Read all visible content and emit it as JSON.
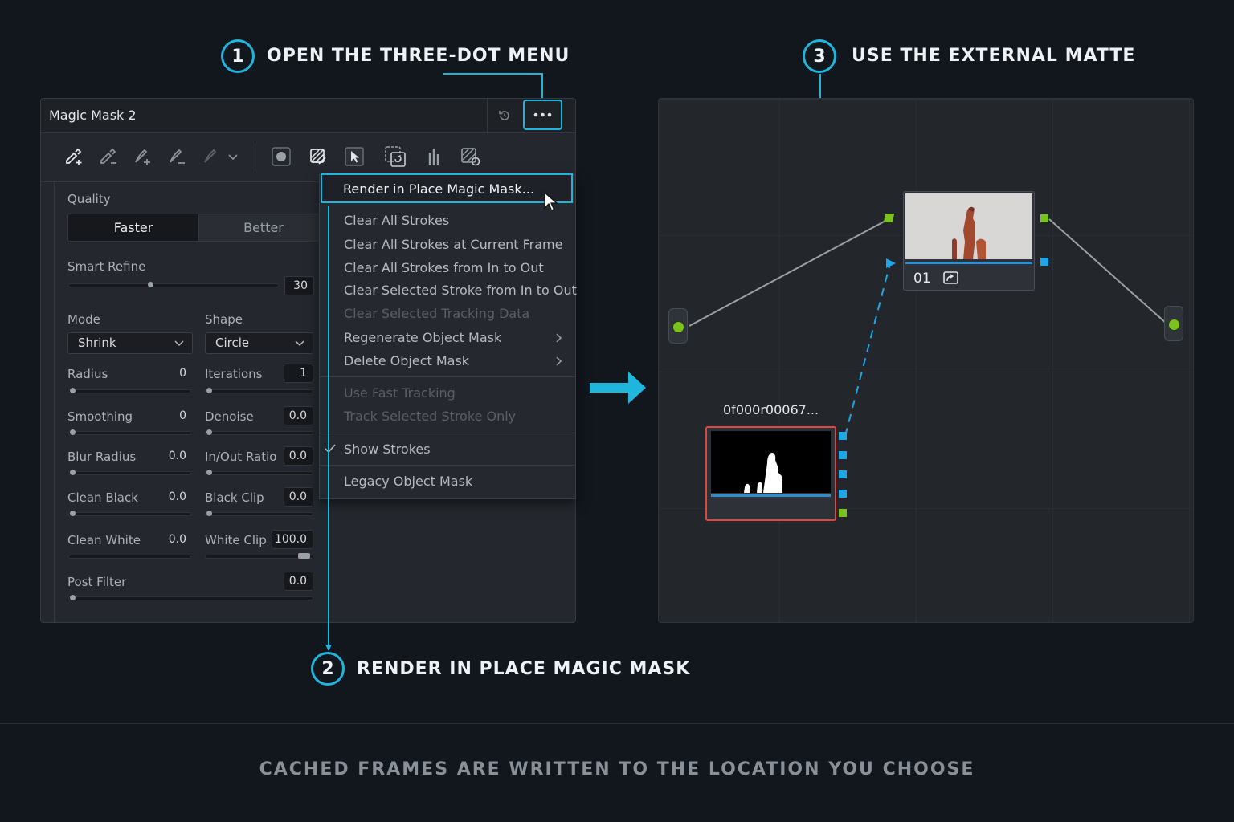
{
  "steps": [
    {
      "number": "1",
      "label": "OPEN THE THREE-DOT MENU"
    },
    {
      "number": "2",
      "label": "RENDER IN PLACE MAGIC MASK"
    },
    {
      "number": "3",
      "label": "USE THE EXTERNAL MATTE"
    }
  ],
  "panel": {
    "title": "Magic Mask 2",
    "quality": {
      "label": "Quality",
      "options": [
        "Faster",
        "Better"
      ],
      "selected": "Faster"
    },
    "smart_refine": {
      "label": "Smart Refine",
      "value": "30"
    },
    "mode": {
      "label": "Mode",
      "value": "Shrink"
    },
    "shape": {
      "label": "Shape",
      "value": "Circle"
    },
    "radius": {
      "label": "Radius",
      "value": "0"
    },
    "iterations": {
      "label": "Iterations",
      "value": "1"
    },
    "smoothing": {
      "label": "Smoothing",
      "value": "0"
    },
    "denoise": {
      "label": "Denoise",
      "value": "0.0"
    },
    "blur_radius": {
      "label": "Blur Radius",
      "value": "0.0"
    },
    "inout_ratio": {
      "label": "In/Out Ratio",
      "value": "0.0"
    },
    "clean_black": {
      "label": "Clean Black",
      "value": "0.0"
    },
    "black_clip": {
      "label": "Black Clip",
      "value": "0.0"
    },
    "clean_white": {
      "label": "Clean White",
      "value": "0.0"
    },
    "white_clip": {
      "label": "White Clip",
      "value": "100.0"
    },
    "post_filter": {
      "label": "Post Filter",
      "value": "0.0"
    }
  },
  "menu": {
    "highlighted": "Render in Place Magic Mask...",
    "items": [
      "Clear All Strokes",
      "Clear All Strokes at Current Frame",
      "Clear All Strokes from In to Out",
      "Clear Selected Stroke from In to Out",
      "Clear Selected Tracking Data",
      "Regenerate Object Mask",
      "Delete Object Mask",
      "Use Fast Tracking",
      "Track Selected Stroke Only",
      "Show Strokes",
      "Legacy Object Mask"
    ]
  },
  "nodes": {
    "node_01_label": "01",
    "matte_label": "0f000r00067..."
  },
  "footer": "CACHED FRAMES ARE WRITTEN TO THE LOCATION YOU CHOOSE",
  "colors": {
    "accent": "#1fb6de",
    "background": "#12161d",
    "node_selected": "#e0483c",
    "port_green": "#7cc21f",
    "port_blue": "#1ea7e8"
  }
}
